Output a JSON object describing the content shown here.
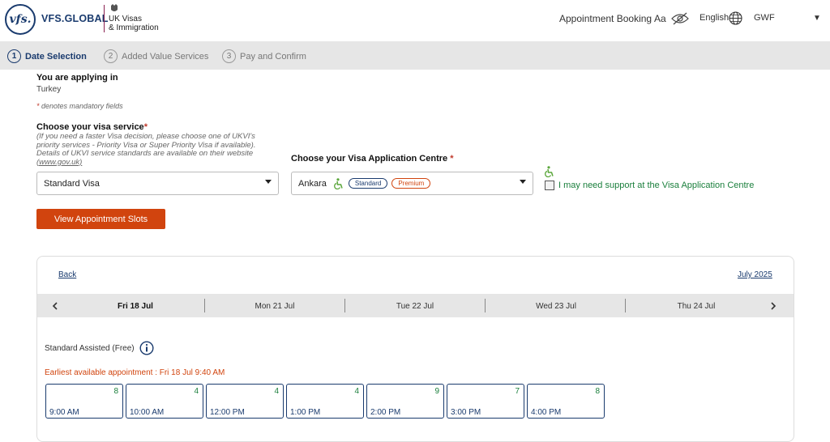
{
  "header": {
    "brand_logo": "vfs.",
    "brand_name": "VFS.GLOBAL",
    "ukvi_line1": "UK Visas",
    "ukvi_line2": "& Immigration",
    "appointment_booking": "Appointment Booking",
    "text_size": "Aa",
    "language": "English",
    "currency": "GWF",
    "caret": "▼"
  },
  "stepper": [
    {
      "num": "1",
      "label": "Date Selection",
      "active": true
    },
    {
      "num": "2",
      "label": "Added Value Services",
      "active": false
    },
    {
      "num": "3",
      "label": "Pay and Confirm",
      "active": false
    }
  ],
  "form": {
    "applying_in_label": "You are applying in",
    "applying_in_value": "Turkey",
    "mandatory_star": "*",
    "mandatory_note": " denotes mandatory fields",
    "visa_service_label": "Choose your visa service",
    "visa_service_help": "(If you need a faster Visa decision, please choose one of UKVI's priority services - Priority Visa or Super Priority Visa if available). Details of UKVI service standards are available on their website",
    "visa_service_link": "(www.gov.uk)",
    "visa_service_value": "Standard Visa",
    "centre_label": "Choose your Visa Application Centre",
    "centre_value": "Ankara",
    "badge_standard": "Standard",
    "badge_premium": "Premium",
    "support_label": "I may need support at the Visa Application Centre",
    "view_slots_button": "View Appointment Slots"
  },
  "calendar": {
    "back": "Back",
    "month": "July 2025",
    "dates": [
      "Fri 18 Jul",
      "Mon 21 Jul",
      "Tue 22 Jul",
      "Wed 23 Jul",
      "Thu 24 Jul"
    ],
    "service_type": "Standard Assisted (Free)",
    "earliest": "Earliest available appointment : Fri 18 Jul 9:40 AM",
    "slots": [
      {
        "time": "9:00 AM",
        "count": "8"
      },
      {
        "time": "10:00 AM",
        "count": "4"
      },
      {
        "time": "12:00 PM",
        "count": "4"
      },
      {
        "time": "1:00 PM",
        "count": "4"
      },
      {
        "time": "2:00 PM",
        "count": "9"
      },
      {
        "time": "3:00 PM",
        "count": "7"
      },
      {
        "time": "4:00 PM",
        "count": "8"
      }
    ]
  },
  "colors": {
    "brand_navy": "#1a3b6e",
    "primary_orange": "#d1440e",
    "accent_green": "#1a7f3c",
    "required_red": "#c0392b"
  }
}
